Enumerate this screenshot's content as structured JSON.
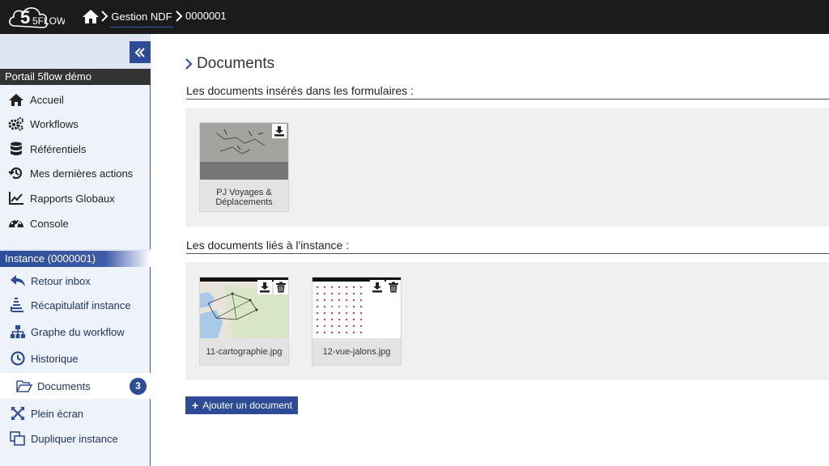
{
  "topbar": {
    "logo_text": "5FLOW",
    "breadcrumb": {
      "home_icon": "home-icon",
      "workflow": "Gestion NDF",
      "instance_id": "0000001"
    }
  },
  "sidebar": {
    "collapse_icon": "double-chevron-left-icon",
    "portal_title": "Portail 5flow démo",
    "portal_items": [
      {
        "label": "Accueil",
        "icon": "home-icon"
      },
      {
        "label": "Workflows",
        "icon": "gears-icon"
      },
      {
        "label": "Référentiels",
        "icon": "database-icon"
      },
      {
        "label": "Mes dernières actions",
        "icon": "history-icon"
      },
      {
        "label": "Rapports Globaux",
        "icon": "line-chart-icon"
      },
      {
        "label": "Console",
        "icon": "dashboard-icon"
      }
    ],
    "instance_title": "Instance (0000001)",
    "instance_items": [
      {
        "label": "Retour inbox",
        "icon": "reply-icon"
      },
      {
        "label": "Récapitulatif instance",
        "icon": "summary-icon"
      },
      {
        "label": "Graphe du workflow",
        "icon": "sitemap-icon"
      },
      {
        "label": "Historique",
        "icon": "clock-icon"
      },
      {
        "label": "Documents",
        "icon": "folder-open-icon",
        "active": true,
        "badge": "3"
      },
      {
        "label": "Plein écran",
        "icon": "fullscreen-icon"
      },
      {
        "label": "Dupliquer instance",
        "icon": "copy-icon"
      }
    ]
  },
  "main": {
    "title": "Documents",
    "form_docs_title": "Les documents insérés dans les formulaires :",
    "form_docs": [
      {
        "label": "PJ Voyages & Déplacements",
        "actions": [
          "download-icon"
        ]
      }
    ],
    "instance_docs_title": "Les documents liés à l'instance :",
    "instance_docs": [
      {
        "label": "11-cartographie.jpg",
        "actions": [
          "download-icon",
          "trash-icon"
        ]
      },
      {
        "label": "12-vue-jalons.jpg",
        "actions": [
          "download-icon",
          "trash-icon"
        ]
      }
    ],
    "add_button": "Ajouter un document"
  },
  "colors": {
    "accent": "#2d4b96",
    "topbar": "#1b1b1b",
    "sidebar": "#dde5f1",
    "doc_area": "#f0f0f0"
  }
}
